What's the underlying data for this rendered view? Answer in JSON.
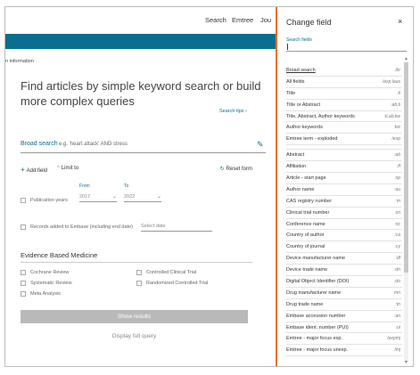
{
  "nav": {
    "items": [
      "Search",
      "Emtree",
      "Jou"
    ]
  },
  "breadcrumb": "n information",
  "headline": "Find articles by simple keyword search or build more complex queries",
  "search_tips": "Search tips",
  "search": {
    "label": "Broad search",
    "placeholder": "e.g. 'heart attack' AND stress"
  },
  "add_field": "Add field",
  "limit_to": "Limit to",
  "reset_form": "Reset form",
  "pub_years": {
    "label": "Publication years",
    "from_label": "From",
    "to_label": "To",
    "from_value": "2017",
    "to_value": "2022"
  },
  "records_added": {
    "label": "Records added to Embase (including end date)",
    "placeholder": "Select date"
  },
  "ebm": {
    "title": "Evidence Based Medicine",
    "options": [
      "Cochrane Review",
      "Systematic Review",
      "Meta Analysis",
      "Controlled Clinical Trial",
      "Randomized Controlled Trial"
    ]
  },
  "show_results": "Show results",
  "display_query": "Display full query",
  "panel": {
    "title": "Change field",
    "close": "×",
    "search_fields_label": "Search fields",
    "items": [
      {
        "name": "Broad search",
        "code": "/br"
      },
      {
        "name": "All fields",
        "code": "/exp.laus"
      },
      {
        "name": "Title",
        "code": ":ti"
      },
      {
        "name": "Title or Abstract",
        "code": ":ab,ti"
      },
      {
        "name": "Title, Abstract, Author keywords",
        "code": ":ti,ab,kw"
      },
      {
        "name": "Author keywords",
        "code": ":kw"
      },
      {
        "name": "Emtree term - exploded",
        "code": "/exp"
      },
      {
        "name": "Abstract",
        "code": ":ab"
      },
      {
        "name": "Affiliation",
        "code": ":ff"
      },
      {
        "name": "Article - start page",
        "code": ":sp"
      },
      {
        "name": "Author name",
        "code": ":au"
      },
      {
        "name": "CAS registry number",
        "code": ":m"
      },
      {
        "name": "Clinical trial number",
        "code": ":cn"
      },
      {
        "name": "Conference name",
        "code": ":nc"
      },
      {
        "name": "Country of author",
        "code": ":ca"
      },
      {
        "name": "Country of journal",
        "code": ":cy"
      },
      {
        "name": "Device manufacturer name",
        "code": ":df"
      },
      {
        "name": "Device trade name",
        "code": ":dn"
      },
      {
        "name": "Digital Object Identifier (DOI)",
        "code": ":do"
      },
      {
        "name": "Drug manufacturer name",
        "code": ":mn"
      },
      {
        "name": "Drug trade name",
        "code": ":tn"
      },
      {
        "name": "Embase accession number",
        "code": ":an"
      },
      {
        "name": "Embase ident. number (PUI)",
        "code": ":ui"
      },
      {
        "name": "Emtree - major focus exp.",
        "code": "/expmj"
      },
      {
        "name": "Emtree - major focus unexp.",
        "code": "/mj"
      }
    ]
  }
}
